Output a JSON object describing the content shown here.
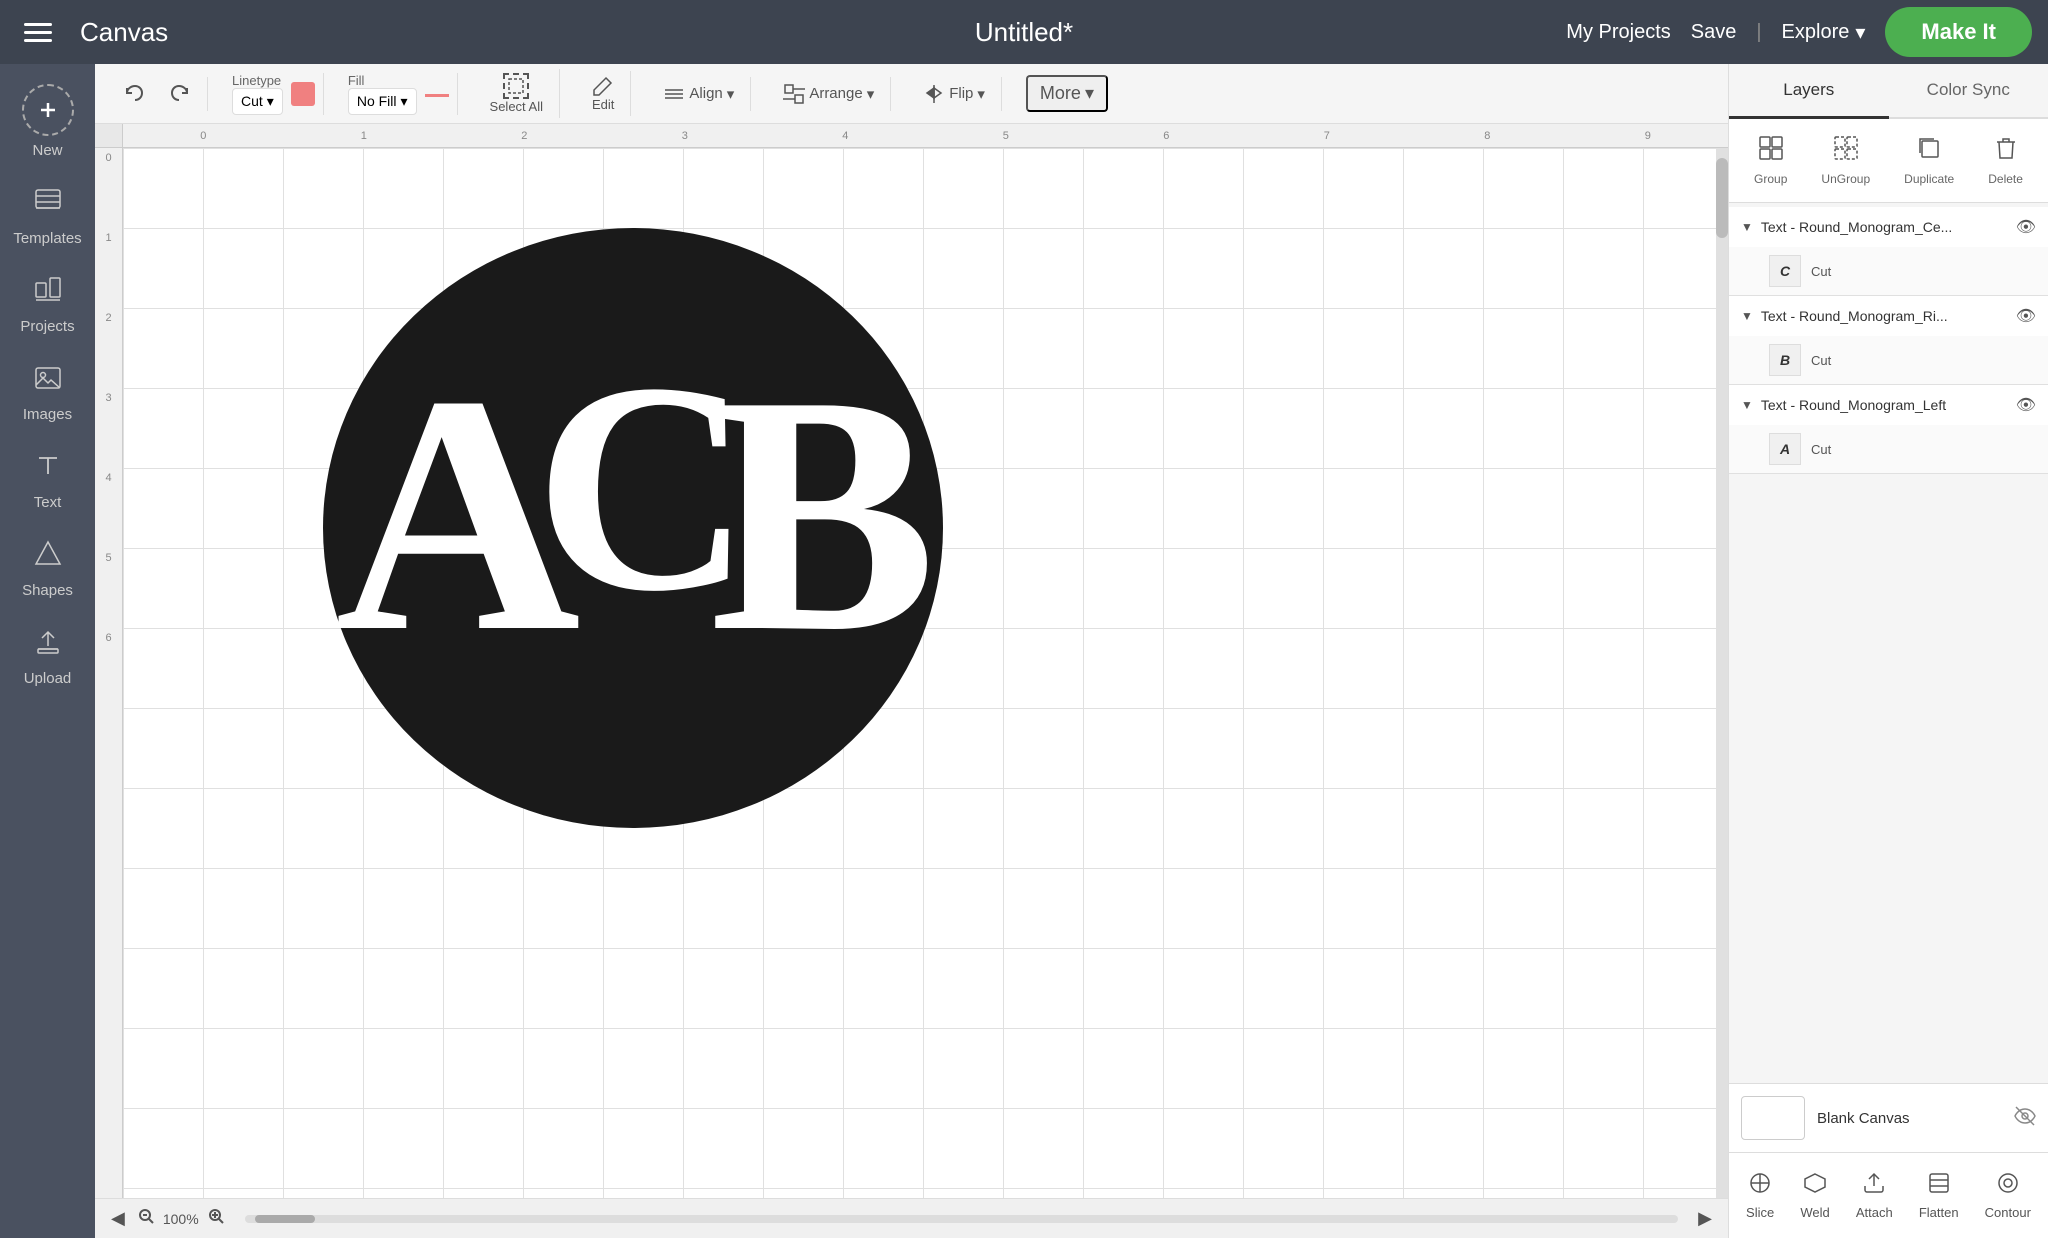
{
  "app": {
    "title": "Canvas",
    "project_title": "Untitled*"
  },
  "nav": {
    "my_projects": "My Projects",
    "save": "Save",
    "explore": "Explore",
    "make_it": "Make It"
  },
  "toolbar": {
    "linetype_label": "Linetype",
    "linetype_value": "Cut",
    "fill_label": "Fill",
    "fill_value": "No Fill",
    "select_all": "Select All",
    "edit": "Edit",
    "align": "Align",
    "arrange": "Arrange",
    "flip": "Flip",
    "more": "More"
  },
  "sidebar": {
    "items": [
      {
        "label": "New",
        "icon": "+"
      },
      {
        "label": "Templates",
        "icon": "T"
      },
      {
        "label": "Projects",
        "icon": "⊞"
      },
      {
        "label": "Images",
        "icon": "🖼"
      },
      {
        "label": "Text",
        "icon": "T"
      },
      {
        "label": "Shapes",
        "icon": "✦"
      },
      {
        "label": "Upload",
        "icon": "↑"
      }
    ]
  },
  "ruler": {
    "h_marks": [
      "0",
      "1",
      "2",
      "3",
      "4",
      "5",
      "6",
      "7",
      "8",
      "9"
    ],
    "v_marks": [
      "0",
      "1",
      "2",
      "3",
      "4",
      "5",
      "6"
    ]
  },
  "layers_panel": {
    "tabs": [
      "Layers",
      "Color Sync"
    ],
    "actions": {
      "group": "Group",
      "ungroup": "UnGroup",
      "duplicate": "Duplicate",
      "delete": "Delete"
    },
    "layers": [
      {
        "name": "Text - Round_Monogram_Ce...",
        "visible": true,
        "children": [
          {
            "char": "C",
            "cut_label": "Cut"
          }
        ]
      },
      {
        "name": "Text - Round_Monogram_Ri...",
        "visible": true,
        "children": [
          {
            "char": "B",
            "cut_label": "Cut"
          }
        ]
      },
      {
        "name": "Text - Round_Monogram_Left",
        "visible": true,
        "children": [
          {
            "char": "A",
            "cut_label": "Cut"
          }
        ]
      }
    ],
    "blank_canvas": {
      "label": "Blank Canvas",
      "visible": false
    },
    "bottom_actions": [
      {
        "label": "Slice",
        "icon": "⧉"
      },
      {
        "label": "Weld",
        "icon": "⬡"
      },
      {
        "label": "Attach",
        "icon": "📎"
      },
      {
        "label": "Flatten",
        "icon": "⬛"
      },
      {
        "label": "Contour",
        "icon": "◉"
      }
    ]
  },
  "canvas": {
    "zoom": "100%"
  }
}
